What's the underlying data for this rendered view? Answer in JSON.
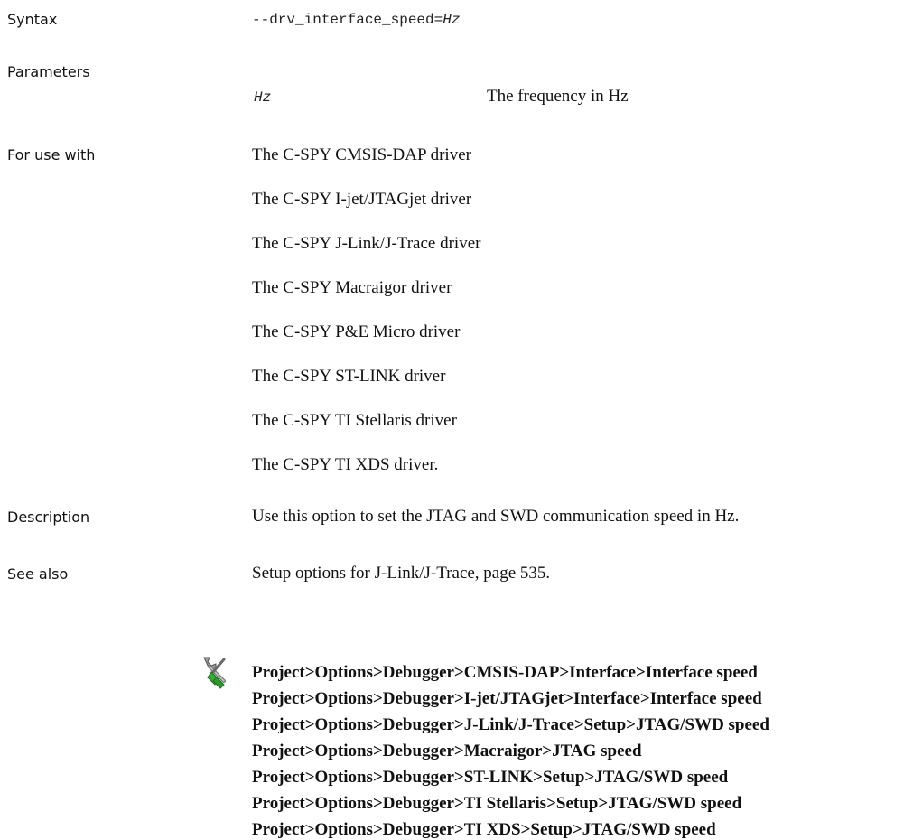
{
  "sections": {
    "syntax_label": "Syntax",
    "parameters_label": "Parameters",
    "for_use_with_label": "For use with",
    "description_label": "Description",
    "see_also_label": "See also"
  },
  "syntax": {
    "prefix": "--drv_interface_speed=",
    "arg": "Hz"
  },
  "parameters": [
    {
      "name": "Hz",
      "description": "The frequency in Hz"
    }
  ],
  "for_use_with": [
    "The C-SPY CMSIS-DAP driver",
    "The C-SPY I-jet/JTAGjet driver",
    "The C-SPY J-Link/J-Trace driver",
    "The C-SPY Macraigor driver",
    "The C-SPY P&E Micro driver",
    "The C-SPY ST-LINK driver",
    "The C-SPY TI Stellaris driver",
    "The C-SPY TI XDS driver."
  ],
  "description": "Use this option to set the JTAG and SWD communication speed in Hz.",
  "see_also": "Setup options for J-Link/J-Trace, page 535.",
  "ide_icon": "ide-options-tool-icon",
  "ide_paths": [
    "Project>Options>Debugger>CMSIS-DAP>Interface>Interface speed",
    "Project>Options>Debugger>I-jet/JTAGjet>Interface>Interface speed",
    "Project>Options>Debugger>J-Link/J-Trace>Setup>JTAG/SWD speed",
    "Project>Options>Debugger>Macraigor>JTAG speed",
    "Project>Options>Debugger>ST-LINK>Setup>JTAG/SWD speed",
    "Project>Options>Debugger>TI Stellaris>Setup>JTAG/SWD speed",
    "Project>Options>Debugger>TI XDS>Setup>JTAG/SWD speed"
  ],
  "colors": {
    "text": "#111111",
    "icon_green": "#3aa83a",
    "icon_grey": "#8c8c8c"
  }
}
